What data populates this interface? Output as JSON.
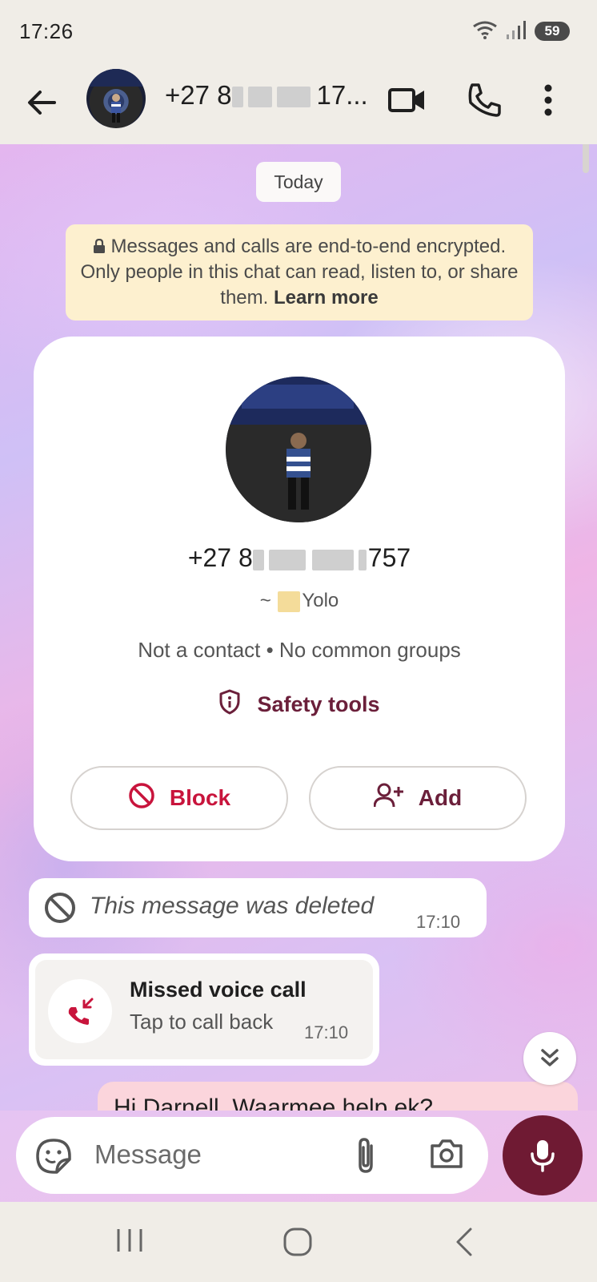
{
  "status_bar": {
    "time": "17:26",
    "battery": "59"
  },
  "header": {
    "contact_title_prefix": "+27 8",
    "contact_title_suffix": "17...",
    "back_label": "Back",
    "video_call_label": "Video call",
    "voice_call_label": "Voice call",
    "menu_label": "More options"
  },
  "chat": {
    "date_chip": "Today",
    "encryption_notice": "Messages and calls are end-to-end encrypted. Only people in this chat can read, listen to, or share them.",
    "encryption_link": "Learn more",
    "contact_card": {
      "phone_prefix": "+27 8",
      "phone_suffix": "757",
      "name_prefix": "~",
      "name": "Yolo",
      "subtitle": "Not a contact • No common groups",
      "safety_tools": "Safety tools",
      "block_label": "Block",
      "add_label": "Add"
    },
    "messages": [
      {
        "type": "deleted",
        "text": "This message was deleted",
        "time": "17:10"
      },
      {
        "type": "missed_call",
        "title": "Missed voice call",
        "subtitle": "Tap to call back",
        "time": "17:10"
      },
      {
        "type": "outgoing",
        "text": "Hi Darnell, Waarmee help ek?"
      }
    ]
  },
  "composer": {
    "placeholder": "Message"
  },
  "colors": {
    "accent": "#6f1a33",
    "block_red": "#c8143c",
    "encryption_bg": "#fdf0cf",
    "outgoing_bubble": "#fbd5dc"
  }
}
